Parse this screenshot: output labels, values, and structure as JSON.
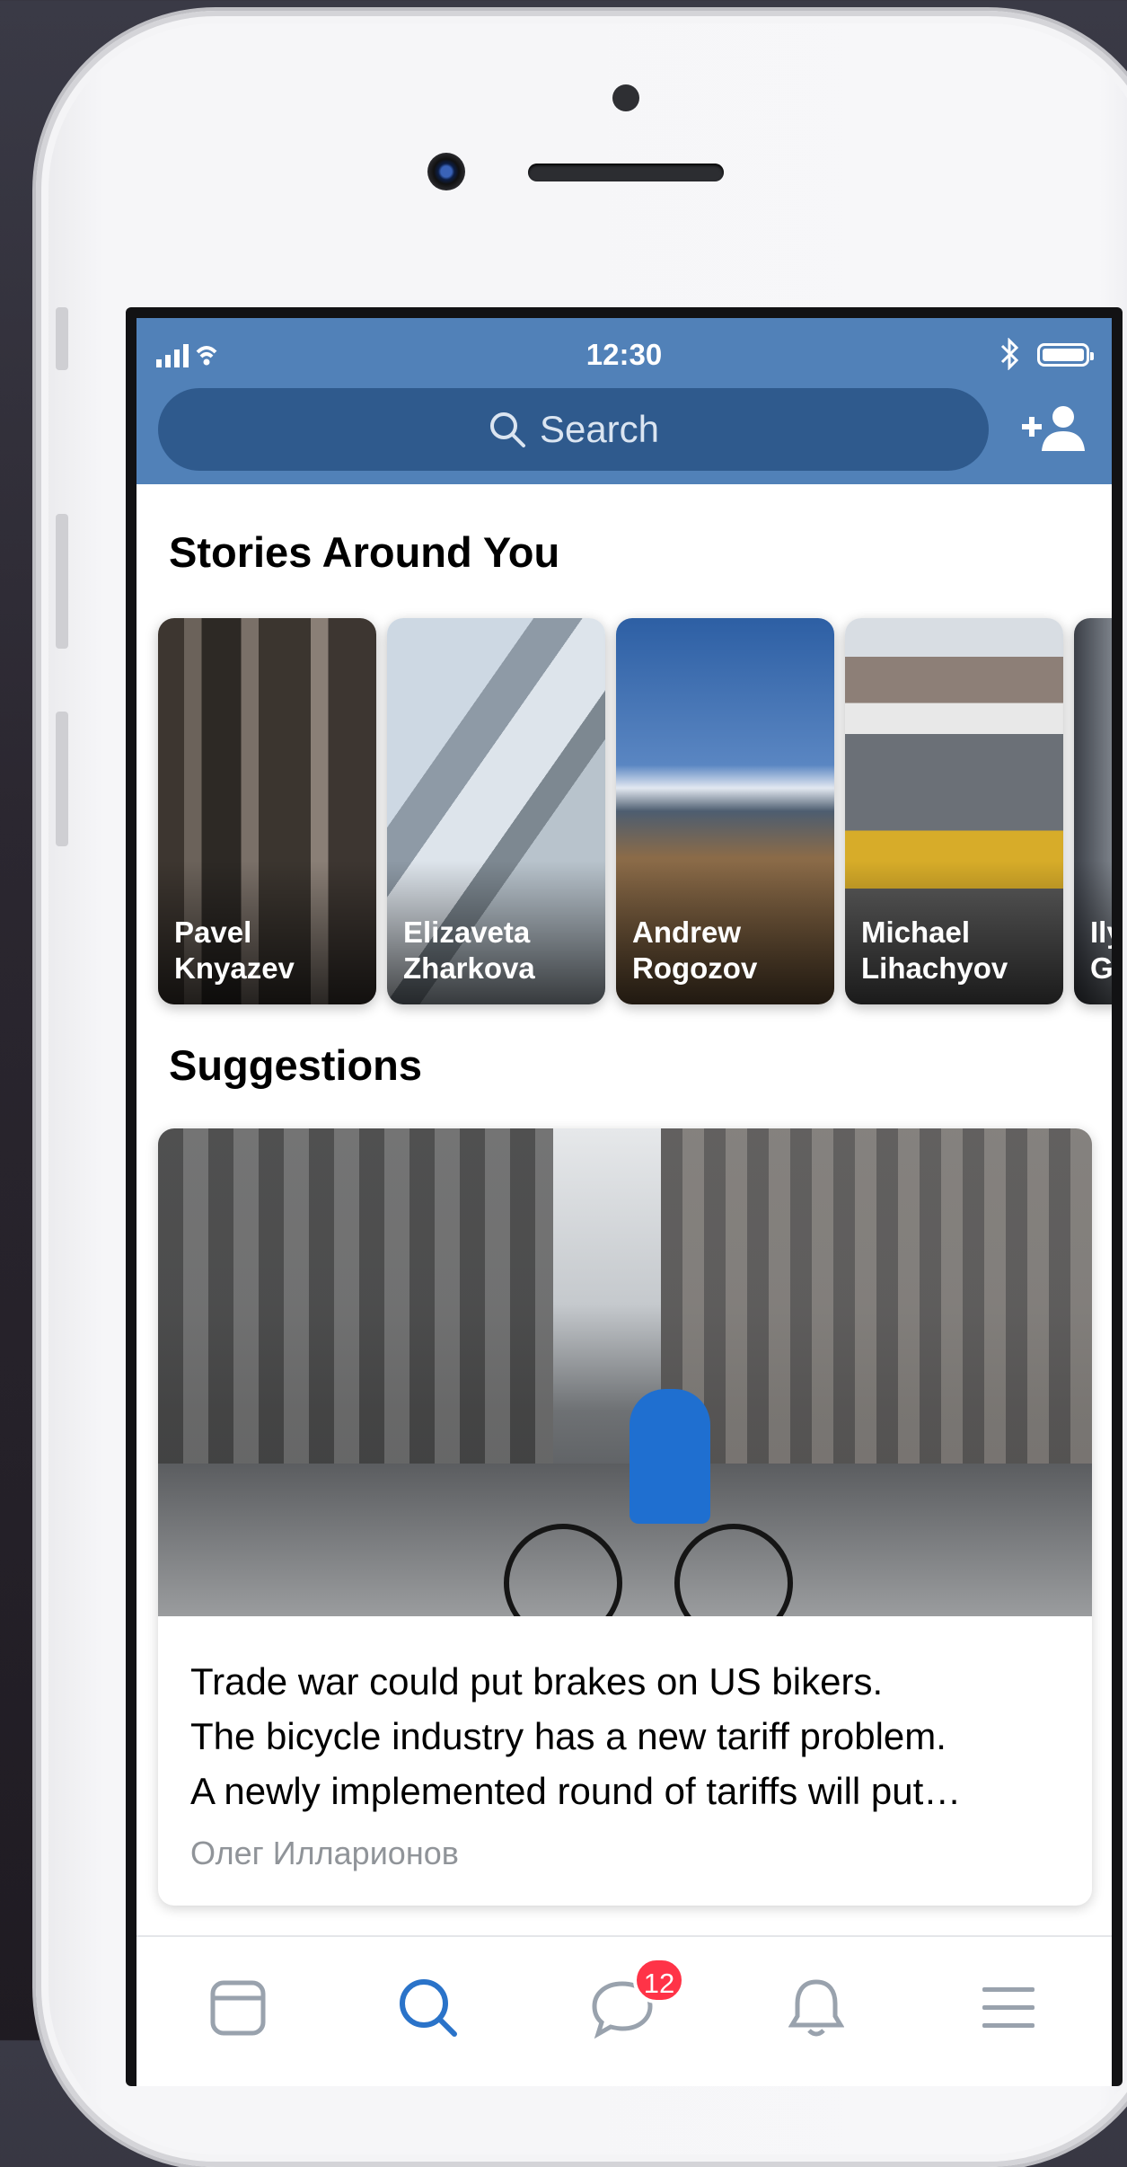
{
  "status_bar": {
    "time": "12:30"
  },
  "search": {
    "placeholder": "Search"
  },
  "stories": {
    "title": "Stories Around You",
    "items": [
      {
        "first": "Pavel",
        "last": "Knyazev"
      },
      {
        "first": "Elizaveta",
        "last": "Zharkova"
      },
      {
        "first": "Andrew",
        "last": "Rogozov"
      },
      {
        "first": "Michael",
        "last": "Lihachyov"
      },
      {
        "first": "Ily",
        "last": "G"
      }
    ]
  },
  "suggestions": {
    "title": "Suggestions",
    "card": {
      "line1": "Trade war could put brakes on US bikers.",
      "line2": "The bicycle industry has a new tariff problem.",
      "line3": "A newly implemented round of tariffs will put…",
      "author": "Олег Илларионов"
    }
  },
  "tabbar": {
    "messages_badge": "12"
  },
  "colors": {
    "header": "#5181b8",
    "search_bg": "#2f5a8d",
    "active_tab": "#2a73c9",
    "inactive_tab": "#99a2ad",
    "badge": "#ff3347"
  },
  "icons": [
    "signal-icon",
    "wifi-icon",
    "bluetooth-icon",
    "battery-icon",
    "search-icon",
    "add-friend-icon",
    "news-tab-icon",
    "search-tab-icon",
    "messages-tab-icon",
    "notifications-tab-icon",
    "menu-tab-icon"
  ]
}
